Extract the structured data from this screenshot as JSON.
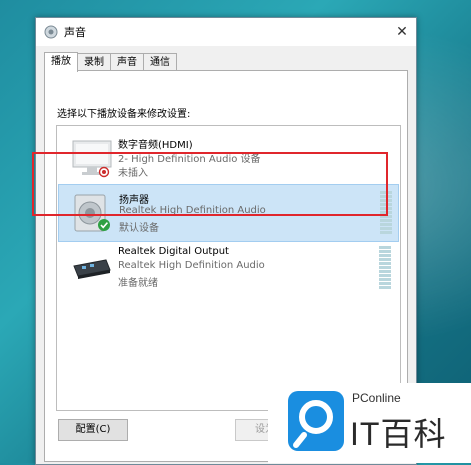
{
  "window": {
    "title": "声音",
    "close_glyph": "✕",
    "title_icon": "speaker-icon"
  },
  "tabs": [
    {
      "label": "播放",
      "active": true
    },
    {
      "label": "录制",
      "active": false
    },
    {
      "label": "声音",
      "active": false
    },
    {
      "label": "通信",
      "active": false
    }
  ],
  "playback": {
    "instruction": "选择以下播放设备来修改设置:",
    "devices": [
      {
        "name": "数字音频(HDMI)",
        "description": "2- High Definition Audio 设备",
        "status": "未插入",
        "icon": "monitor-icon",
        "selected": false
      },
      {
        "name": "扬声器",
        "description": "Realtek High Definition Audio",
        "status": "默认设备",
        "icon": "speaker-icon",
        "selected": true
      },
      {
        "name": "Realtek Digital Output",
        "description": "Realtek High Definition Audio",
        "status": "准备就绪",
        "icon": "digital-output-icon",
        "selected": false
      }
    ]
  },
  "buttons": {
    "configure": "配置(C)",
    "set_default": "设为默认"
  },
  "watermark": {
    "small": "PConline",
    "big": "IT百科"
  },
  "colors": {
    "selection": "#cce4f7",
    "highlight": "#e0262c",
    "watermark_blue": "#1a8ee0"
  }
}
